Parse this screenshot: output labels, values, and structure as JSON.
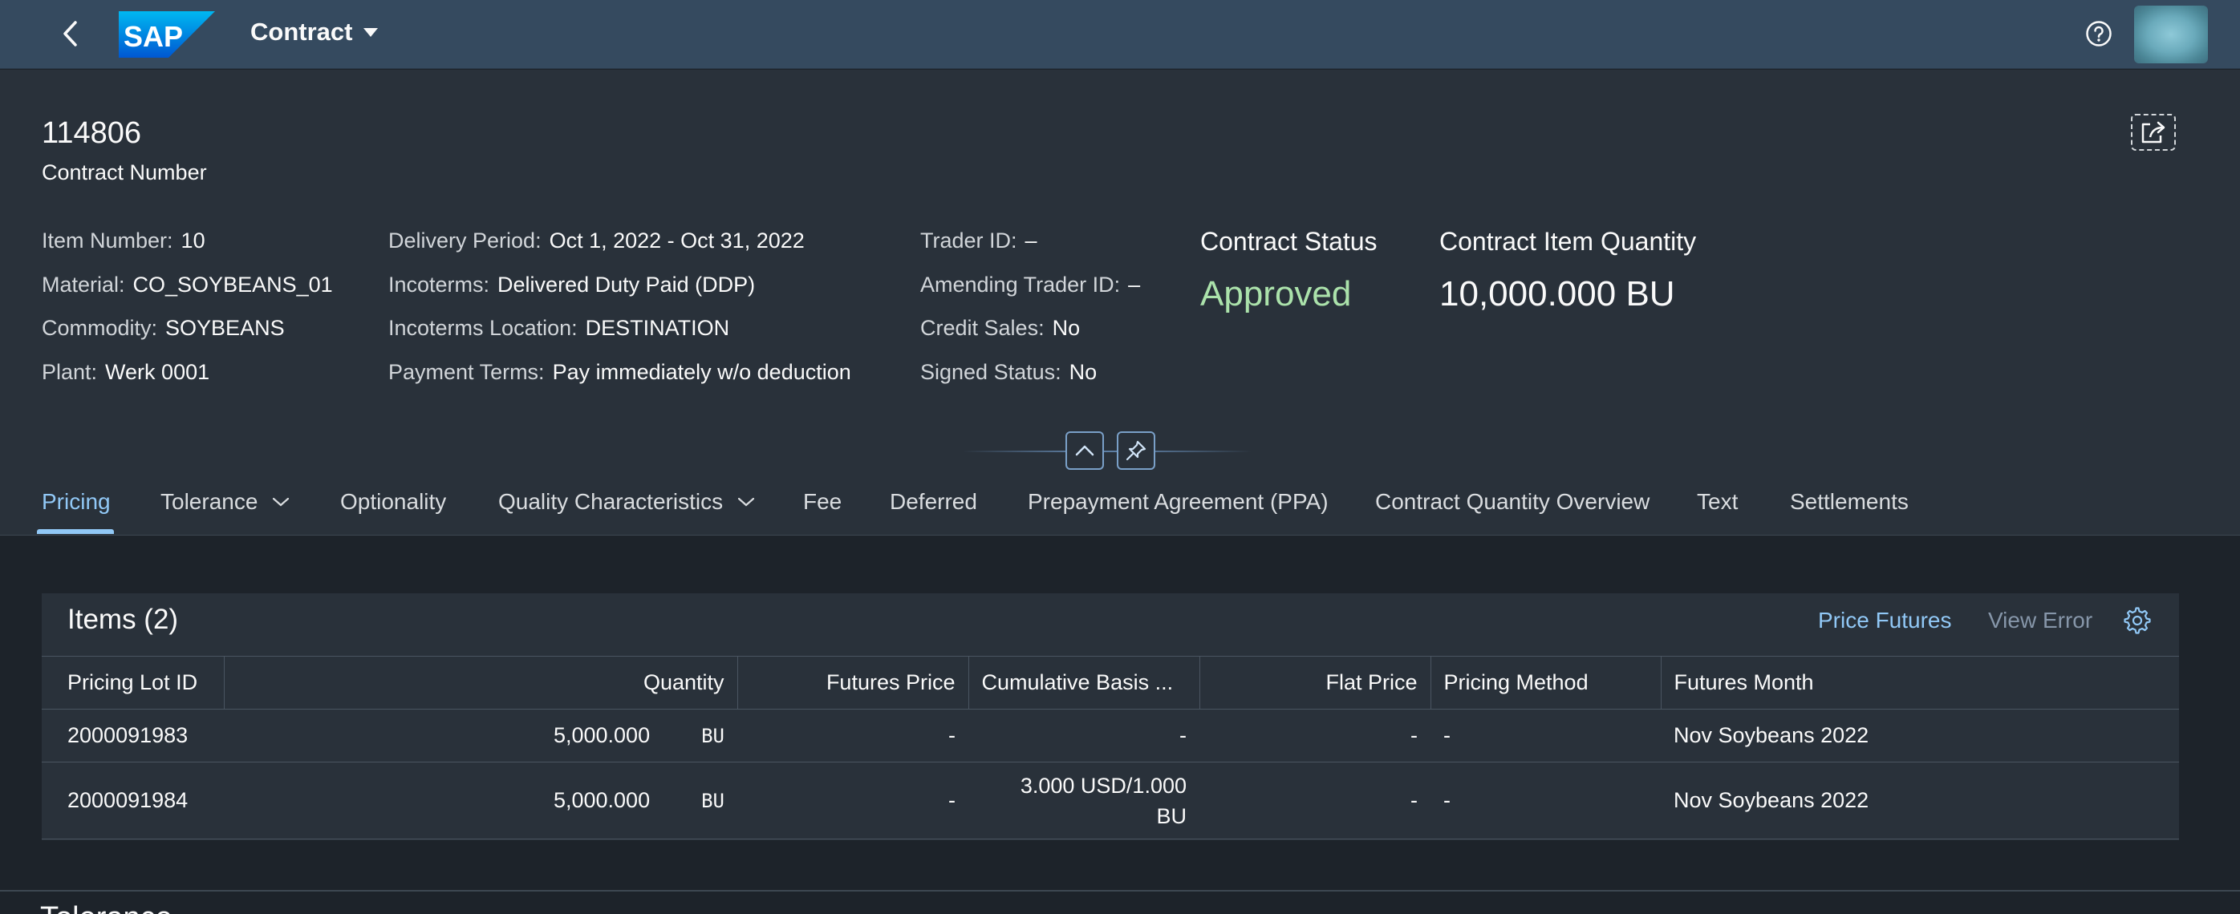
{
  "shell": {
    "logo_text": "SAP",
    "app_title": "Contract"
  },
  "header": {
    "title": "114806",
    "subtitle": "Contract Number",
    "col1": [
      {
        "label": "Item Number:",
        "value": "10"
      },
      {
        "label": "Material:",
        "value": "CO_SOYBEANS_01"
      },
      {
        "label": "Commodity:",
        "value": "SOYBEANS"
      },
      {
        "label": "Plant:",
        "value": "Werk 0001"
      }
    ],
    "col2": [
      {
        "label": "Delivery Period:",
        "value": "Oct 1, 2022 - Oct 31, 2022"
      },
      {
        "label": "Incoterms:",
        "value": "Delivered Duty Paid (DDP)"
      },
      {
        "label": "Incoterms Location:",
        "value": "DESTINATION"
      },
      {
        "label": "Payment Terms:",
        "value": "Pay immediately w/o deduction"
      }
    ],
    "col3": [
      {
        "label": "Trader ID:",
        "value": "–"
      },
      {
        "label": "Amending Trader ID:",
        "value": "–"
      },
      {
        "label": "Credit Sales:",
        "value": "No"
      },
      {
        "label": "Signed Status:",
        "value": "No"
      }
    ],
    "status": {
      "label": "Contract Status",
      "value": "Approved",
      "color": "#abe2ab"
    },
    "quantity": {
      "label": "Contract Item Quantity",
      "value": "10,000.000 BU"
    }
  },
  "tabs": [
    {
      "label": "Pricing",
      "active": true,
      "dropdown": false
    },
    {
      "label": "Tolerance",
      "active": false,
      "dropdown": true
    },
    {
      "label": "Optionality",
      "active": false,
      "dropdown": false
    },
    {
      "label": "Quality Characteristics",
      "active": false,
      "dropdown": true
    },
    {
      "label": "Fee",
      "active": false,
      "dropdown": false
    },
    {
      "label": "Deferred",
      "active": false,
      "dropdown": false
    },
    {
      "label": "Prepayment Agreement (PPA)",
      "active": false,
      "dropdown": false
    },
    {
      "label": "Contract Quantity Overview",
      "active": false,
      "dropdown": false
    },
    {
      "label": "Text",
      "active": false,
      "dropdown": false
    },
    {
      "label": "Settlements",
      "active": false,
      "dropdown": false
    }
  ],
  "items": {
    "title": "Items (2)",
    "actions": {
      "price_futures": "Price Futures",
      "view_error": "View Error"
    },
    "columns": [
      "Pricing Lot ID",
      "Quantity",
      "Futures Price",
      "Cumulative Basis ...",
      "Flat Price",
      "Pricing Method",
      "Futures Month"
    ],
    "rows": [
      {
        "lot_id": "2000091983",
        "quantity": "5,000.000",
        "unit": "BU",
        "futures_price": "-",
        "basis_1": "-",
        "basis_2": "",
        "flat_price": "-",
        "method": "-",
        "month": "Nov Soybeans 2022"
      },
      {
        "lot_id": "2000091984",
        "quantity": "5,000.000",
        "unit": "BU",
        "futures_price": "-",
        "basis_1": "3.000 USD/1.000",
        "basis_2": "BU",
        "flat_price": "-",
        "method": "-",
        "month": "Nov Soybeans 2022"
      }
    ]
  },
  "next_section_title": "Tolerance"
}
